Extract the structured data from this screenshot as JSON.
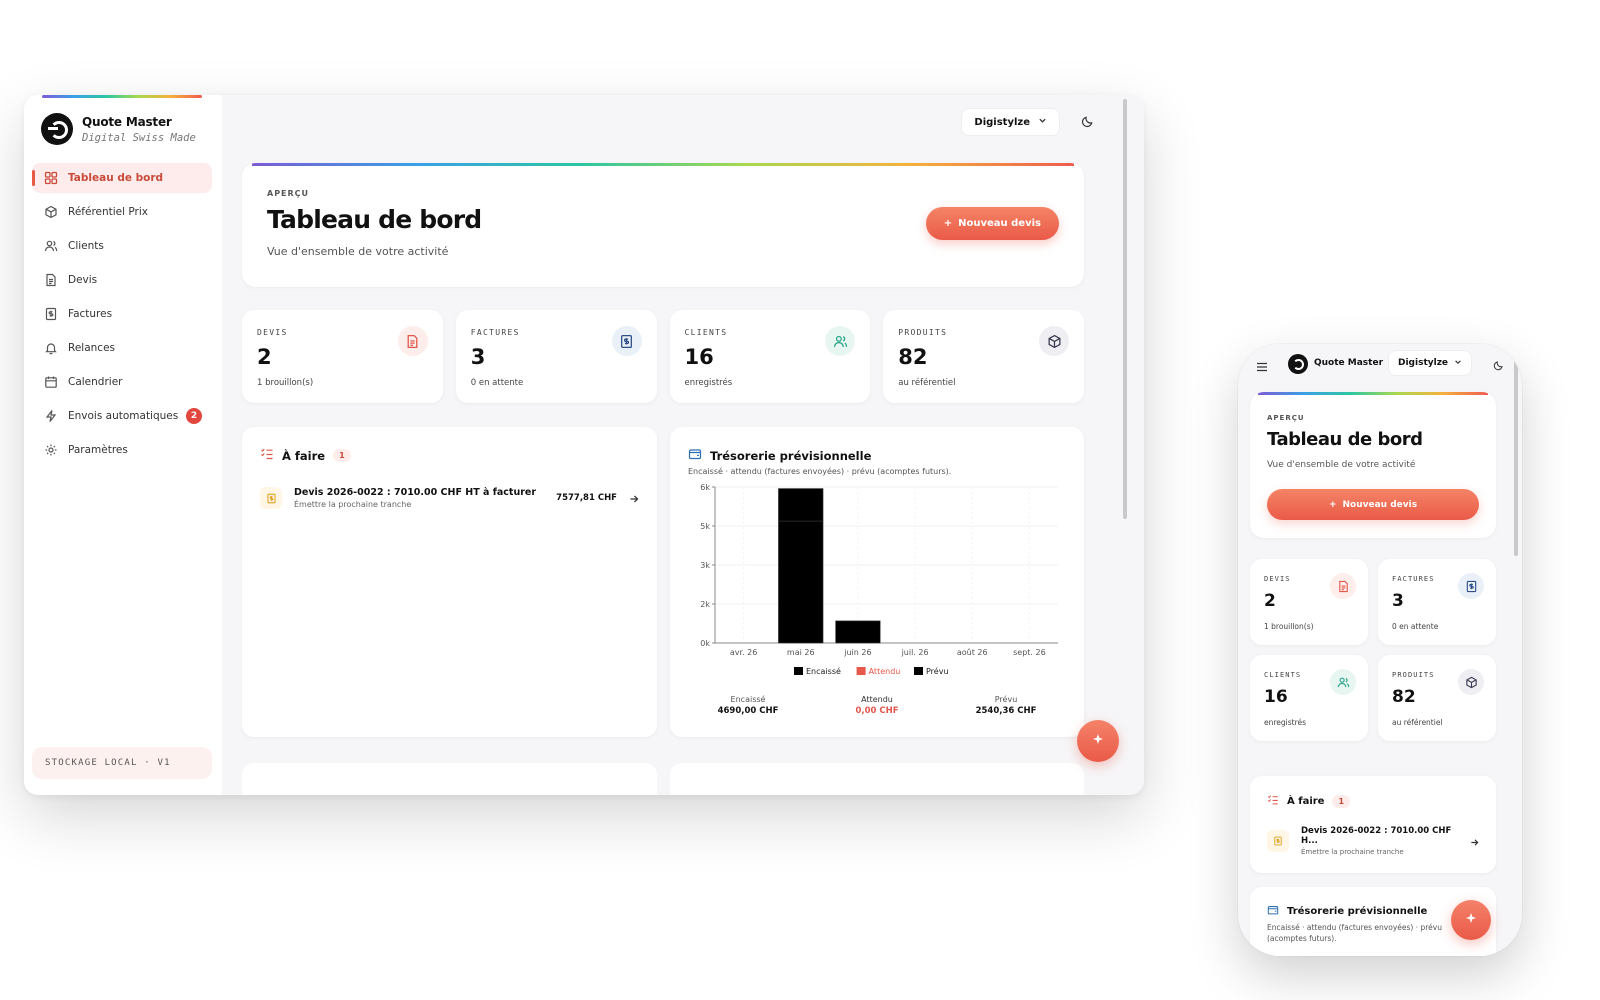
{
  "brand": {
    "name": "Quote Master",
    "tagline": "Digital Swiss Made"
  },
  "sidebar": {
    "items": [
      {
        "label": "Tableau de bord",
        "icon": "dashboard-icon",
        "active": true
      },
      {
        "label": "Référentiel Prix",
        "icon": "cube-icon"
      },
      {
        "label": "Clients",
        "icon": "users-icon"
      },
      {
        "label": "Devis",
        "icon": "document-icon"
      },
      {
        "label": "Factures",
        "icon": "invoice-icon"
      },
      {
        "label": "Relances",
        "icon": "bell-icon"
      },
      {
        "label": "Calendrier",
        "icon": "calendar-icon"
      },
      {
        "label": "Envois automatiques",
        "icon": "bolt-icon",
        "badge": "2"
      },
      {
        "label": "Paramètres",
        "icon": "gear-icon"
      }
    ],
    "storage_label": "STOCKAGE LOCAL · V1"
  },
  "header": {
    "org_name": "Digistylze"
  },
  "hero": {
    "eyebrow": "APERÇU",
    "title": "Tableau de bord",
    "subtitle": "Vue d'ensemble de votre activité",
    "cta_label": "Nouveau devis"
  },
  "stats": [
    {
      "label": "DEVIS",
      "value": "2",
      "hint": "1 brouillon(s)",
      "icon": "document-icon",
      "color": "#e2574c"
    },
    {
      "label": "FACTURES",
      "value": "3",
      "hint": "0 en attente",
      "icon": "invoice-icon",
      "color": "#2d4e86"
    },
    {
      "label": "CLIENTS",
      "value": "16",
      "hint": "enregistrés",
      "icon": "users-icon",
      "color": "#2aa58a"
    },
    {
      "label": "PRODUITS",
      "value": "82",
      "hint": "au référentiel",
      "icon": "cube-icon",
      "color": "#3b3b52"
    }
  ],
  "todo": {
    "title": "À faire",
    "count": "1",
    "items": [
      {
        "title": "Devis 2026-0022 : 7010.00 CHF HT à facturer",
        "title_mobile": "Devis 2026-0022 : 7010.00 CHF H...",
        "desc": "Émettre la prochaine tranche",
        "amount": "7577,81 CHF"
      }
    ]
  },
  "treasury": {
    "title": "Trésorerie prévisionnelle",
    "subtitle": "Encaissé · attendu (factures envoyées) · prévu (acomptes futurs).",
    "summary": [
      {
        "label": "Encaissé",
        "value": "4690,00 CHF"
      },
      {
        "label": "Attendu",
        "value": "0,00 CHF"
      },
      {
        "label": "Prévu",
        "value": "2540,36 CHF"
      }
    ]
  },
  "colors": {
    "accent": "#ea5a48",
    "encaisse": "#000000",
    "attendu": "#e8584a",
    "prevu": "#000000"
  },
  "chart_data": {
    "type": "bar",
    "stacked": true,
    "categories": [
      "avr. 26",
      "mai 26",
      "juin 26",
      "juil. 26",
      "août 26",
      "sept. 26"
    ],
    "series": [
      {
        "name": "Encaissé",
        "values": [
          0,
          4690,
          0,
          0,
          0,
          0
        ]
      },
      {
        "name": "Attendu",
        "values": [
          0,
          0,
          0,
          0,
          0,
          0
        ]
      },
      {
        "name": "Prévu",
        "values": [
          0,
          1250,
          850,
          0,
          0,
          0
        ]
      }
    ],
    "y_ticks": [
      "0k",
      "2k",
      "3k",
      "5k",
      "6k"
    ],
    "y_tick_values": [
      0,
      1500,
      3000,
      4500,
      6000
    ],
    "ylim": [
      0,
      6000
    ],
    "legend_position": "bottom",
    "grid": true
  }
}
